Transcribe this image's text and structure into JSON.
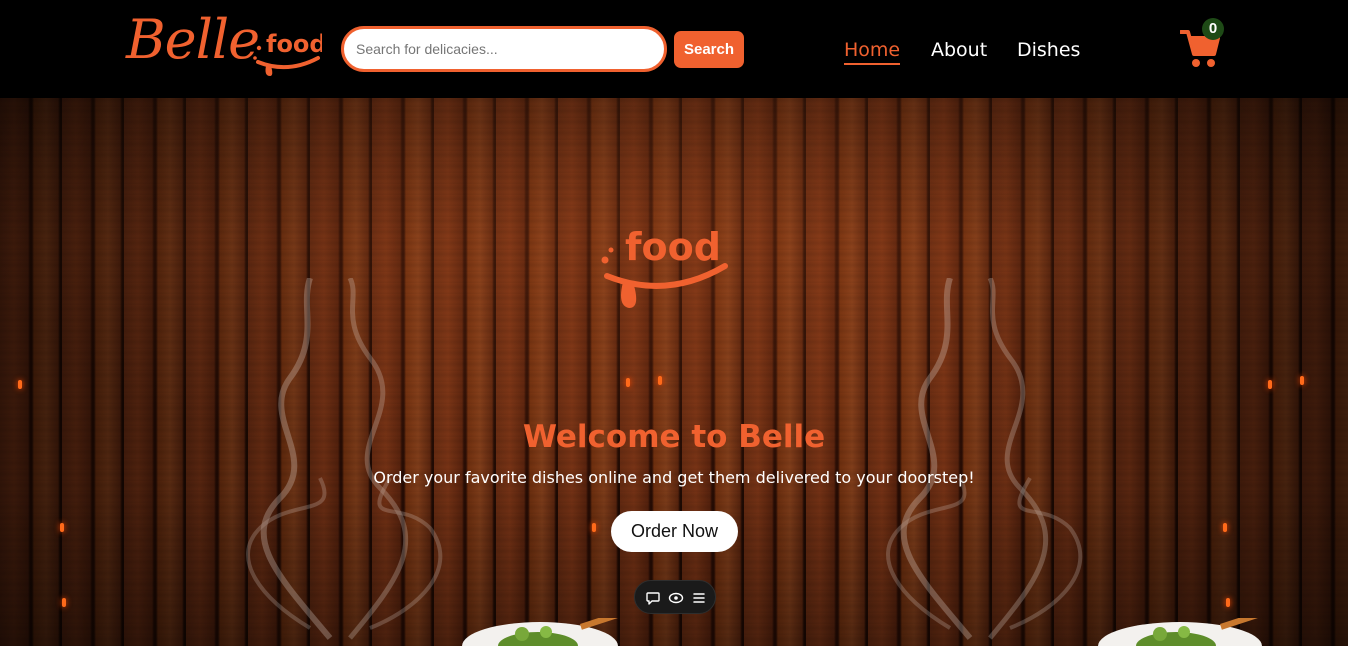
{
  "brand": {
    "name": "Belle",
    "tagline": "food",
    "accent_color": "#f0612f"
  },
  "search": {
    "placeholder": "Search for delicacies...",
    "value": "",
    "button_label": "Search"
  },
  "nav": {
    "items": [
      {
        "label": "Home",
        "active": true
      },
      {
        "label": "About",
        "active": false
      },
      {
        "label": "Dishes",
        "active": false
      }
    ]
  },
  "cart": {
    "count": "0",
    "icon": "shopping-cart-icon",
    "badge_color": "#1e4a16"
  },
  "hero": {
    "logo_text": "food",
    "title": "Welcome to Belle",
    "subtitle": "Order your favorite dishes online and get them delivered to your doorstep!",
    "cta_label": "Order Now"
  },
  "toolbar": {
    "icons": [
      "comment-icon",
      "eye-icon",
      "menu-icon"
    ]
  }
}
